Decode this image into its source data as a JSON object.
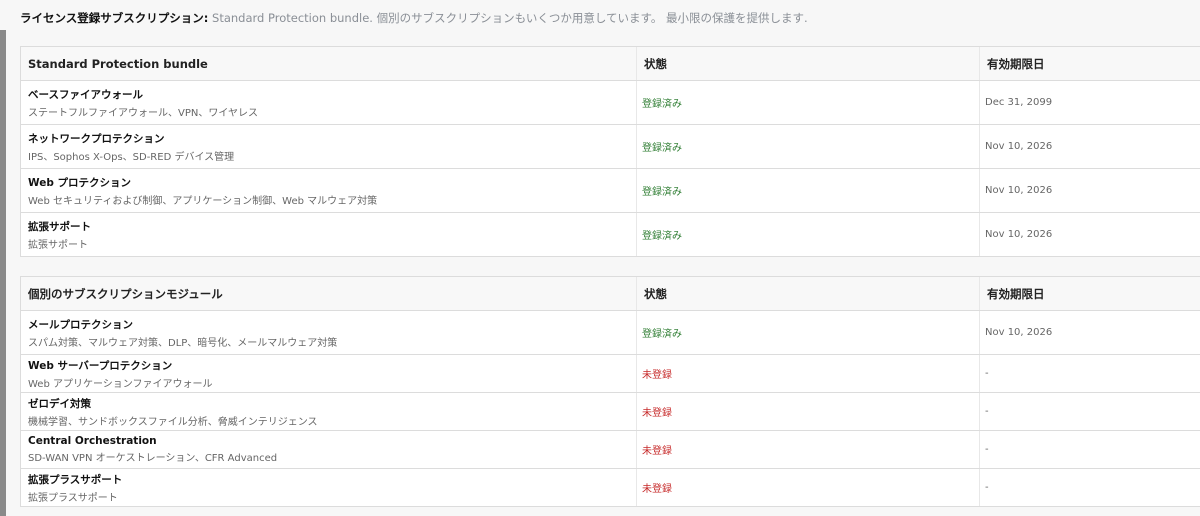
{
  "intro": {
    "label": "ライセンス登録サブスクリプション:",
    "text": "Standard Protection bundle. 個別のサブスクリプションもいくつか用意しています。 最小限の保護を提供します."
  },
  "bundle": {
    "headers": [
      "Standard Protection bundle",
      "状態",
      "有効期限日"
    ],
    "rows": [
      {
        "name": "ベースファイアウォール",
        "desc": "ステートフルファイアウォール、VPN、ワイヤレス",
        "status": "登録済み",
        "expiry": "Dec 31, 2099"
      },
      {
        "name": "ネットワークプロテクション",
        "desc": "IPS、Sophos X-Ops、SD-RED デバイス管理",
        "status": "登録済み",
        "expiry": "Nov 10, 2026"
      },
      {
        "name": "Web プロテクション",
        "desc": "Web セキュリティおよび制御、アプリケーション制御、Web マルウェア対策",
        "status": "登録済み",
        "expiry": "Nov 10, 2026"
      },
      {
        "name": "拡張サポート",
        "desc": "拡張サポート",
        "status": "登録済み",
        "expiry": "Nov 10, 2026"
      }
    ]
  },
  "modules": {
    "headers": [
      "個別のサブスクリプションモジュール",
      "状態",
      "有効期限日"
    ],
    "rows": [
      {
        "name": "メールプロテクション",
        "desc": "スパム対策、マルウェア対策、DLP、暗号化、メールマルウェア対策",
        "status": "登録済み",
        "expiry": "Nov 10, 2026"
      },
      {
        "name": "Web サーバープロテクション",
        "desc": "Web アプリケーションファイアウォール",
        "status": "未登録",
        "expiry": "-"
      },
      {
        "name": "ゼロデイ対策",
        "desc": "機械学習、サンドボックスファイル分析、脅威インテリジェンス",
        "status": "未登録",
        "expiry": "-"
      },
      {
        "name": "Central Orchestration",
        "desc": "SD-WAN VPN オーケストレーション、CFR Advanced",
        "status": "未登録",
        "expiry": "-"
      },
      {
        "name": "拡張プラスサポート",
        "desc": "拡張プラスサポート",
        "status": "未登録",
        "expiry": "-"
      }
    ]
  }
}
